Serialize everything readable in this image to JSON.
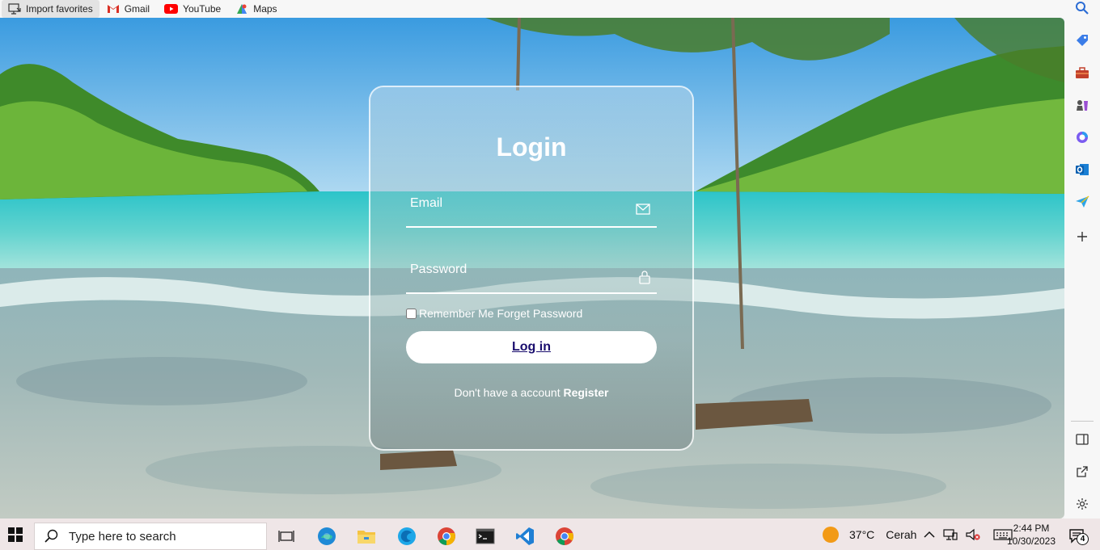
{
  "favorites_bar": {
    "items": [
      {
        "label": "Import favorites",
        "icon": "import-icon"
      },
      {
        "label": "Gmail",
        "icon": "gmail-icon"
      },
      {
        "label": "YouTube",
        "icon": "youtube-icon"
      },
      {
        "label": "Maps",
        "icon": "maps-icon"
      }
    ]
  },
  "login": {
    "title": "Login",
    "email_placeholder": "Email",
    "password_placeholder": "Password",
    "remember_label": "Remember Me Forget Password",
    "login_button": "Log in",
    "register_prompt": "Don't have a account",
    "register_link": "Register"
  },
  "sidebar": {
    "icons": [
      "search-icon",
      "tag-icon",
      "toolbox-icon",
      "chess-icon",
      "office-icon",
      "outlook-icon",
      "send-icon",
      "add-icon",
      "split-screen-icon",
      "external-link-icon",
      "settings-icon"
    ]
  },
  "taskbar": {
    "search_placeholder": "Type here to search",
    "apps": [
      "task-view-icon",
      "edge-icon",
      "file-explorer-icon",
      "edge-beta-icon",
      "chrome-icon",
      "terminal-icon",
      "vscode-icon",
      "chrome-icon"
    ],
    "weather": {
      "temp": "37°C",
      "condition": "Cerah"
    },
    "time": "2:44 PM",
    "date": "10/30/2023",
    "notification_count": "4"
  }
}
